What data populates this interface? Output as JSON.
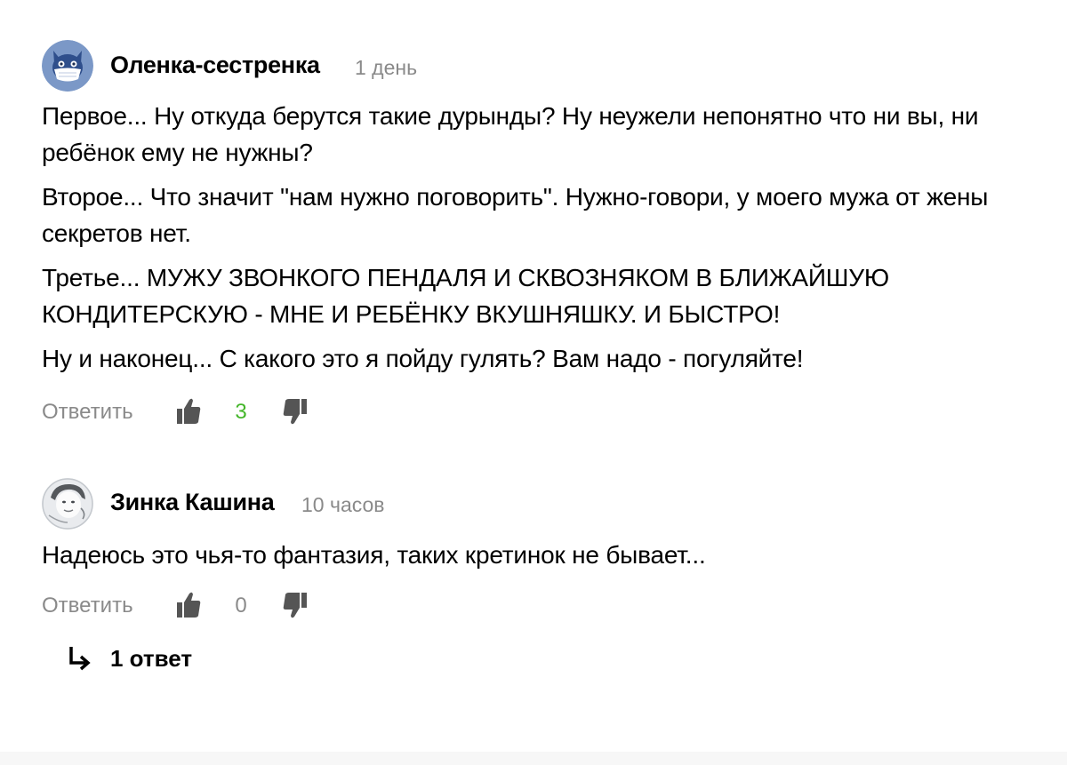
{
  "comments": [
    {
      "author": "Оленка-сестренка",
      "time": "1 день",
      "avatar_icon": "cat-with-mask-avatar",
      "paragraphs": [
        "Первое... Ну откуда берутся такие дурынды? Ну неужели непонятно что ни вы, ни ребёнок ему не нужны?",
        "Второе... Что значит \"нам нужно поговорить\". Нужно-говори, у моего мужа от жены секретов нет.",
        "Третье... МУЖУ ЗВОНКОГО ПЕНДАЛЯ И СКВОЗНЯКОМ В БЛИЖАЙШУЮ КОНДИТЕРСКУЮ - МНЕ И РЕБЁНКУ ВКУШНЯШКУ. И БЫСТРО!",
        "Ну и наконец... С какого это я пойду гулять? Вам надо - погуляйте!"
      ],
      "reply_label": "Ответить",
      "rating": "3",
      "rating_color": "#44b62a"
    },
    {
      "author": "Зинка Кашина",
      "time": "10 часов",
      "avatar_icon": "person-photo-avatar",
      "paragraphs": [
        "Надеюсь это чья-то фантазия, таких кретинок не бывает..."
      ],
      "reply_label": "Ответить",
      "rating": "0",
      "rating_color": "#8a8a8a",
      "replies_label": "1 ответ"
    }
  ],
  "colors": {
    "muted": "#8a8a8a",
    "icon": "#555555",
    "avatar_bg": "#7b98c7",
    "positive": "#44b62a"
  }
}
